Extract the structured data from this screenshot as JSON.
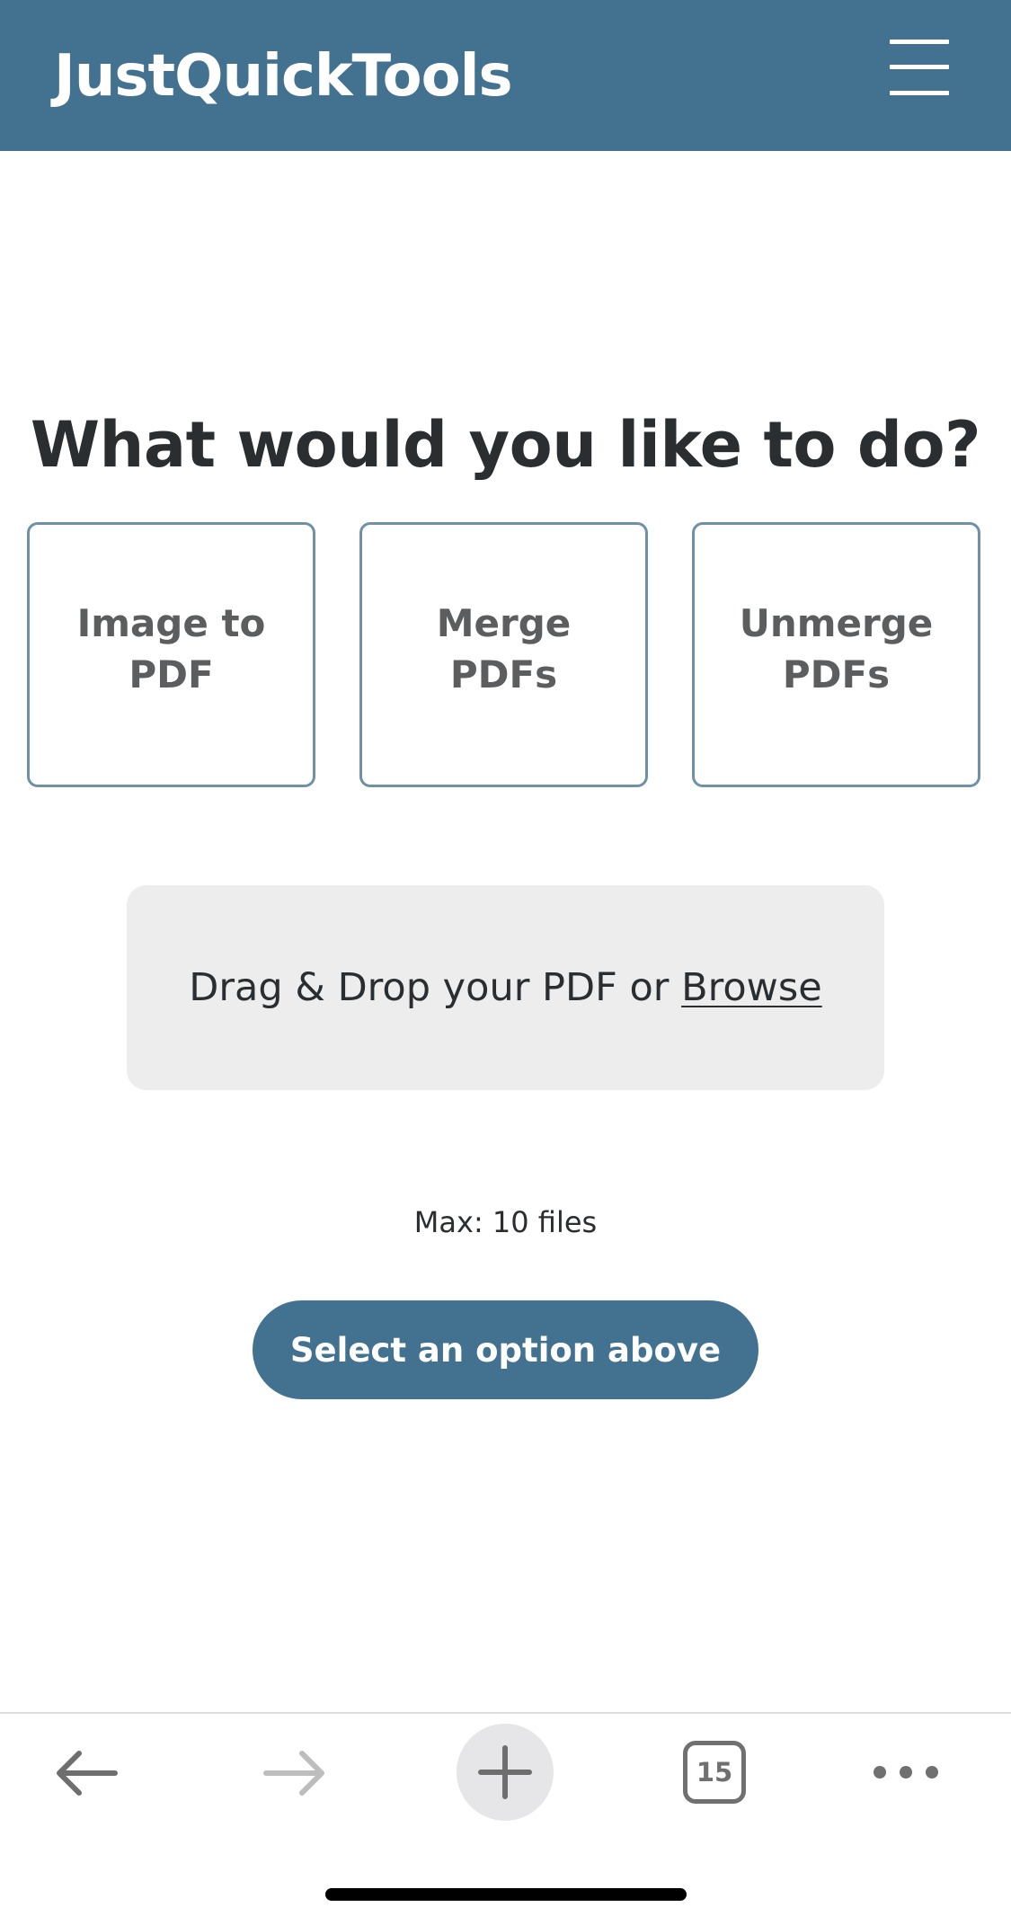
{
  "header": {
    "logo_text": "JustQuickTools",
    "menu_icon": "hamburger-menu-icon",
    "background_color": "#437291"
  },
  "main": {
    "headline": "What would you like to do?",
    "options": [
      {
        "label": "Image to\nPDF"
      },
      {
        "label": "Merge\nPDFs"
      },
      {
        "label": "Unmerge\nPDFs"
      }
    ],
    "dropzone": {
      "text": "Drag & Drop your PDF or ",
      "browse_link": "Browse"
    },
    "max_files": "Max: 10 files",
    "action_button": "Select an option above",
    "accent_color": "#437291"
  },
  "browser_toolbar": {
    "back_icon": "back-arrow-icon",
    "forward_icon": "forward-arrow-icon",
    "new_tab_icon": "plus-icon",
    "tab_count": "15",
    "more_icon": "more-dots-icon"
  }
}
